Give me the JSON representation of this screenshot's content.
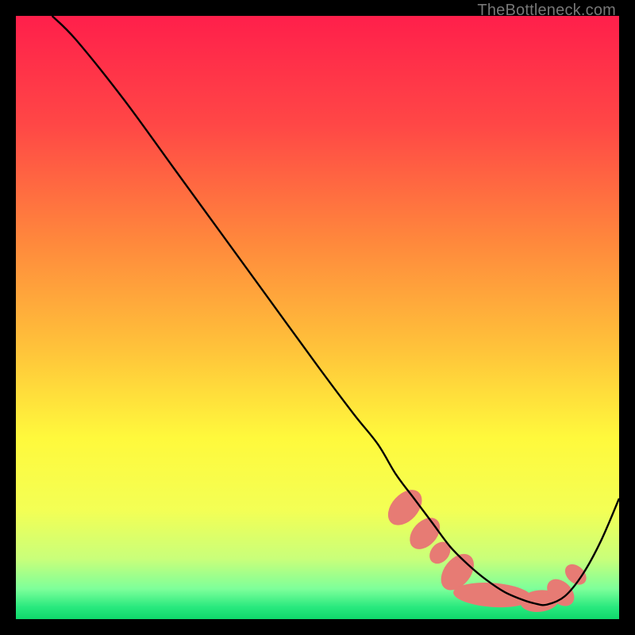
{
  "watermark": "TheBottleneck.com",
  "chart_data": {
    "type": "line",
    "title": "",
    "xlabel": "",
    "ylabel": "",
    "xlim": [
      0,
      100
    ],
    "ylim": [
      0,
      100
    ],
    "gradient_stops": [
      {
        "offset": 0,
        "color": "#ff1f4b"
      },
      {
        "offset": 18,
        "color": "#ff4746"
      },
      {
        "offset": 38,
        "color": "#ff8a3c"
      },
      {
        "offset": 55,
        "color": "#ffc23a"
      },
      {
        "offset": 70,
        "color": "#fff93c"
      },
      {
        "offset": 82,
        "color": "#f3ff55"
      },
      {
        "offset": 90,
        "color": "#c9ff7a"
      },
      {
        "offset": 95,
        "color": "#7dff9a"
      },
      {
        "offset": 98,
        "color": "#29e97e"
      },
      {
        "offset": 100,
        "color": "#0fd86b"
      }
    ],
    "series": [
      {
        "name": "curve",
        "x": [
          6,
          10,
          18,
          26,
          34,
          42,
          50,
          56,
          60,
          63,
          66,
          69,
          72,
          75,
          78,
          81,
          84,
          86,
          88,
          91,
          94,
          97,
          100
        ],
        "y": [
          100,
          96,
          86,
          75,
          64,
          53,
          42,
          34,
          29,
          24,
          20,
          16,
          12,
          9,
          6.5,
          4.5,
          3.2,
          2.6,
          2.4,
          3.8,
          7.5,
          13,
          20
        ]
      }
    ],
    "marker_clusters": [
      {
        "cx": 64.5,
        "cy": 18.5,
        "rx": 2.2,
        "ry": 3.4,
        "rot": 42
      },
      {
        "cx": 67.8,
        "cy": 14.2,
        "rx": 2.0,
        "ry": 3.0,
        "rot": 42
      },
      {
        "cx": 70.3,
        "cy": 11.0,
        "rx": 1.5,
        "ry": 2.0,
        "rot": 40
      },
      {
        "cx": 73.2,
        "cy": 7.8,
        "rx": 2.2,
        "ry": 3.4,
        "rot": 38
      },
      {
        "cx": 79.0,
        "cy": 4.0,
        "rx": 6.5,
        "ry": 2.0,
        "rot": 4
      },
      {
        "cx": 86.8,
        "cy": 3.0,
        "rx": 3.2,
        "ry": 1.8,
        "rot": -6
      },
      {
        "cx": 90.3,
        "cy": 4.4,
        "rx": 1.8,
        "ry": 2.6,
        "rot": -46
      },
      {
        "cx": 92.8,
        "cy": 7.4,
        "rx": 1.4,
        "ry": 2.0,
        "rot": -48
      }
    ],
    "curve_color": "#000000",
    "marker_color": "#e77b74"
  }
}
